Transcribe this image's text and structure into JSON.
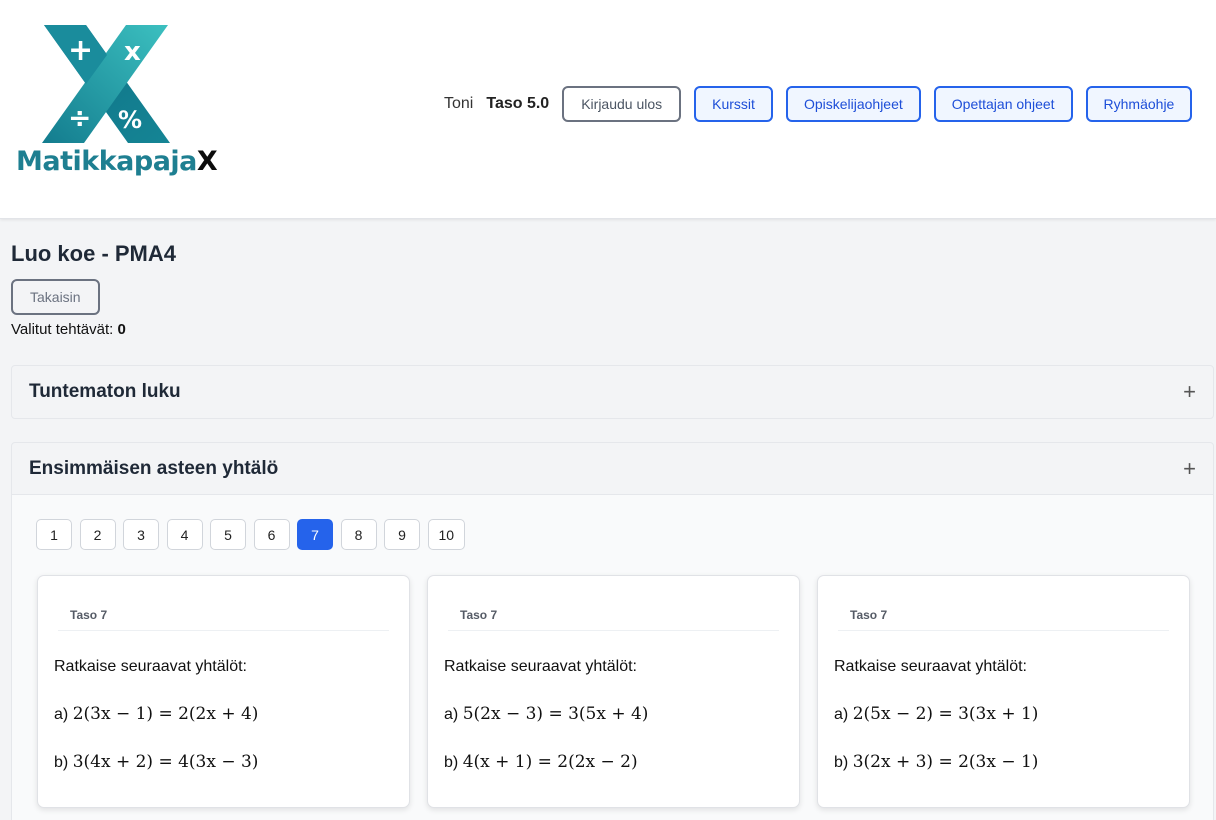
{
  "brand": {
    "name_main": "Matikkapaja",
    "name_suffix": "X",
    "colors": {
      "teal": "#1e7f91",
      "teal_light": "#3cbdbf"
    }
  },
  "nav": {
    "user": "Toni",
    "level": "Taso 5.0",
    "logout": "Kirjaudu ulos",
    "courses": "Kurssit",
    "student_guide": "Opiskelijaohjeet",
    "teacher_guide": "Opettajan ohjeet",
    "group_guide": "Ryhmäohje"
  },
  "page": {
    "title": "Luo koe - PMA4",
    "back": "Takaisin",
    "selected_label": "Valitut tehtävät:",
    "selected_count": "0"
  },
  "sections": [
    {
      "title": "Tuntematon luku",
      "toggle": "+"
    },
    {
      "title": "Ensimmäisen asteen yhtälö",
      "toggle": "+"
    }
  ],
  "pagination": {
    "pages": [
      "1",
      "2",
      "3",
      "4",
      "5",
      "6",
      "7",
      "8",
      "9",
      "10"
    ],
    "active": "7"
  },
  "cards": [
    {
      "level": "Taso 7",
      "intro": "Ratkaise seuraavat yhtälöt:",
      "a_label": "a)",
      "a_eq": "2(3x − 1) = 2(2x + 4)",
      "b_label": "b)",
      "b_eq": "3(4x + 2) = 4(3x − 3)"
    },
    {
      "level": "Taso 7",
      "intro": "Ratkaise seuraavat yhtälöt:",
      "a_label": "a)",
      "a_eq": "5(2x − 3) = 3(5x + 4)",
      "b_label": "b)",
      "b_eq": "4(x + 1) = 2(2x − 2)"
    },
    {
      "level": "Taso 7",
      "intro": "Ratkaise seuraavat yhtälöt:",
      "a_label": "a)",
      "a_eq": "2(5x − 2) = 3(3x + 1)",
      "b_label": "b)",
      "b_eq": "3(2x + 3) = 2(3x − 1)"
    }
  ]
}
